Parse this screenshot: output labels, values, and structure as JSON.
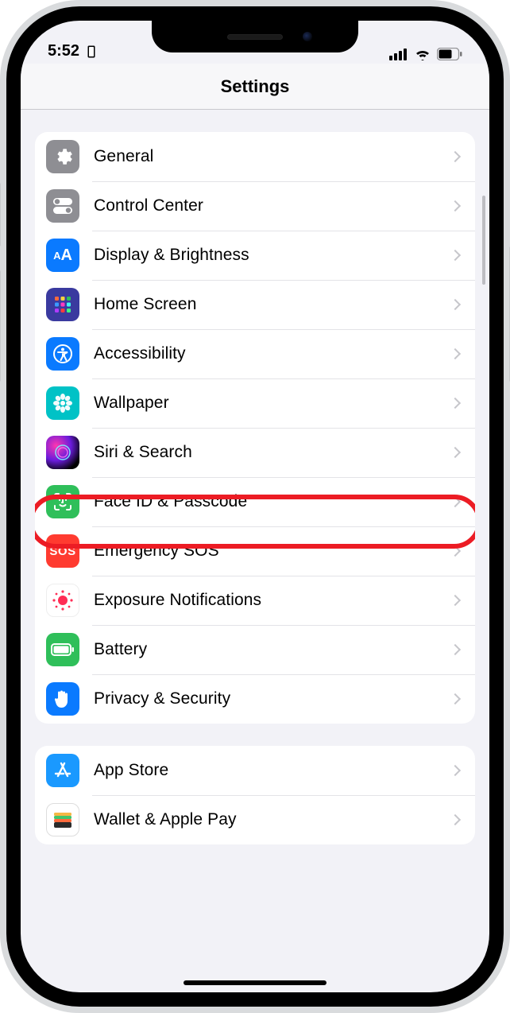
{
  "status": {
    "time": "5:52"
  },
  "header": {
    "title": "Settings"
  },
  "group1": {
    "general": "General",
    "control": "Control Center",
    "display": "Display & Brightness",
    "home": "Home Screen",
    "access": "Accessibility",
    "wall": "Wallpaper",
    "siri": "Siri & Search",
    "face": "Face ID & Passcode",
    "sos_icon": "SOS",
    "sos": "Emergency SOS",
    "expo": "Exposure Notifications",
    "batt": "Battery",
    "priv": "Privacy & Security"
  },
  "group2": {
    "appstore": "App Store",
    "wallet": "Wallet & Apple Pay"
  }
}
